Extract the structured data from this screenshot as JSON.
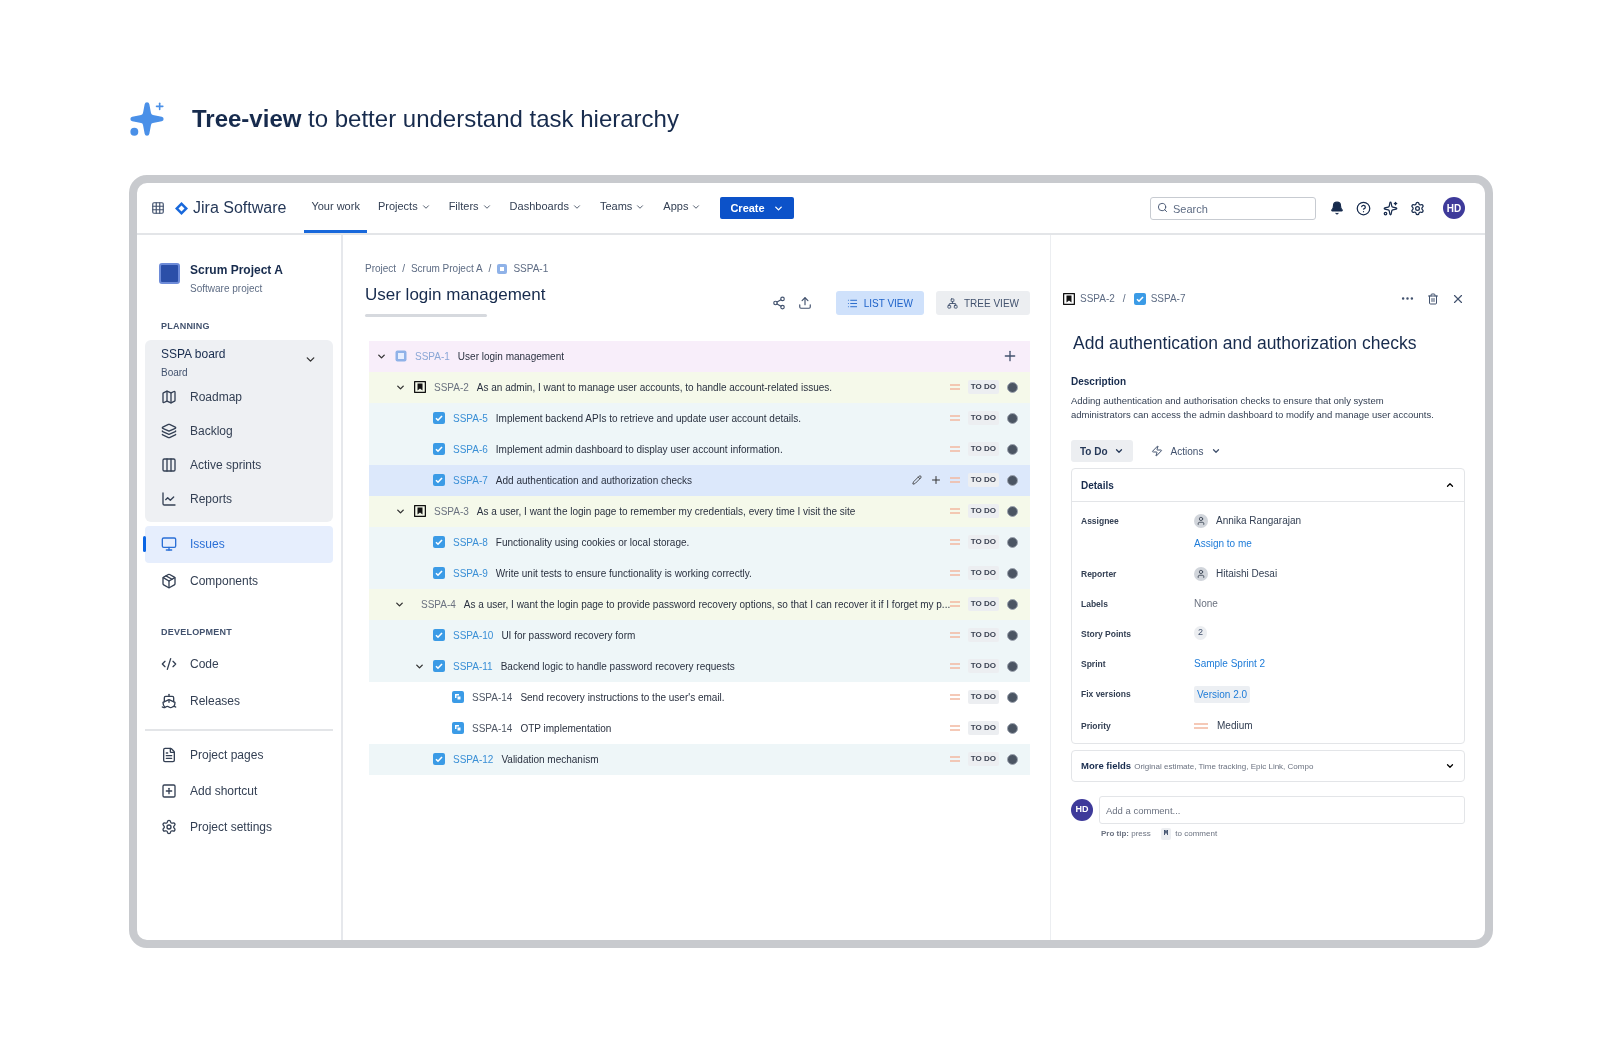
{
  "headline": "**Tree-view** to better understand task hierarchy",
  "topnav": {
    "product": "Jira Software",
    "items": [
      {
        "label": "Your work",
        "selected": true,
        "dropdown": false
      },
      {
        "label": "Projects",
        "selected": false,
        "dropdown": true
      },
      {
        "label": "Filters",
        "selected": false,
        "dropdown": true
      },
      {
        "label": "Dashboards",
        "selected": false,
        "dropdown": true
      },
      {
        "label": "Teams",
        "selected": false,
        "dropdown": true
      },
      {
        "label": "Apps",
        "selected": false,
        "dropdown": true
      }
    ],
    "create": "Create",
    "search": {
      "placeholder": "Search"
    },
    "avatar": "HD"
  },
  "sidebar": {
    "project": {
      "name": "Scrum Project A",
      "type": "Software project"
    },
    "sections": [
      {
        "heading": "PLANNING",
        "items": [
          {
            "kind": "board",
            "label": "SSPA board",
            "sublabel": "Board",
            "expanded": true,
            "children": [
              {
                "label": "Roadmap",
                "selected": false
              },
              {
                "label": "Backlog",
                "selected": false
              },
              {
                "label": "Active sprints",
                "selected": false
              },
              {
                "label": "Reports",
                "selected": false
              }
            ]
          },
          {
            "kind": "link",
            "label": "Issues",
            "selected": true
          },
          {
            "kind": "link",
            "label": "Components",
            "selected": false
          }
        ]
      },
      {
        "heading": "DEVELOPMENT",
        "items": [
          {
            "kind": "link",
            "label": "Code",
            "selected": false
          },
          {
            "kind": "link",
            "label": "Releases",
            "selected": false
          }
        ]
      }
    ],
    "footer": [
      {
        "label": "Project pages"
      },
      {
        "label": "Add shortcut"
      },
      {
        "label": "Project settings"
      }
    ]
  },
  "main": {
    "breadcrumb": [
      "Project",
      "/",
      "Scrum Project A",
      "/",
      "SSPA-1"
    ],
    "title": "User login management",
    "views": [
      {
        "label": "LIST VIEW",
        "selected": true
      },
      {
        "label": "TREE VIEW",
        "selected": false
      }
    ],
    "tree": [
      {
        "kind": "epic",
        "key": "SSPA-1",
        "summary": "User login management",
        "expanded": true,
        "selected": false,
        "children": [
          {
            "kind": "story",
            "key": "SSPA-2",
            "summary": "As an admin, I want to manage user accounts, to handle account-related issues.",
            "status": "TO DO",
            "expanded": true,
            "selected": false,
            "children": [
              {
                "kind": "task",
                "key": "SSPA-5",
                "summary": "Implement backend APIs to retrieve and update user account details.",
                "status": "TO DO",
                "selected": false
              },
              {
                "kind": "task",
                "key": "SSPA-6",
                "summary": "Implement admin dashboard to display user account information.",
                "status": "TO DO",
                "selected": false
              },
              {
                "kind": "task",
                "key": "SSPA-7",
                "summary": "Add authentication and authorization checks",
                "status": "TO DO",
                "selected": true
              }
            ]
          },
          {
            "kind": "story",
            "key": "SSPA-3",
            "summary": "As a user, I want the login page to remember my credentials, every time I visit the site",
            "status": "TO DO",
            "expanded": true,
            "selected": false,
            "children": [
              {
                "kind": "task",
                "key": "SSPA-8",
                "summary": "Functionality using cookies or local storage.",
                "status": "TO DO",
                "selected": false
              },
              {
                "kind": "task",
                "key": "SSPA-9",
                "summary": "Write unit tests to ensure functionality is working correctly.",
                "status": "TO DO",
                "selected": false
              }
            ]
          },
          {
            "kind": "story",
            "key": "SSPA-4",
            "summary": "As a user, I want the login page to provide password recovery options, so that I can recover it if I forget my p...",
            "status": "TO DO",
            "expanded": true,
            "selected": false,
            "children": [
              {
                "kind": "task",
                "key": "SSPA-10",
                "summary": "UI for password recovery form",
                "status": "TO DO",
                "selected": false
              },
              {
                "kind": "task",
                "key": "SSPA-11",
                "summary": "Backend logic to handle password recovery requests",
                "status": "TO DO",
                "expanded": true,
                "selected": false,
                "children": [
                  {
                    "kind": "subtask",
                    "key": "SSPA-14",
                    "summary": "Send recovery instructions to the user's email.",
                    "status": "TO DO",
                    "selected": false
                  },
                  {
                    "kind": "subtask",
                    "key": "SSPA-14",
                    "summary": "OTP implementation",
                    "status": "TO DO",
                    "selected": false
                  }
                ]
              },
              {
                "kind": "task",
                "key": "SSPA-12",
                "summary": "Validation mechanism",
                "status": "TO DO",
                "selected": false
              }
            ]
          }
        ]
      }
    ]
  },
  "detail": {
    "breadcrumb": [
      "SSPA-2",
      "/",
      "SSPA-7"
    ],
    "title": "Add authentication and authorization checks",
    "description_label": "Description",
    "description": "Adding authentication and authorisation checks to ensure that only system administrators can access the admin dashboard to modify and manage user accounts.",
    "status": "To Do",
    "actions": "Actions",
    "details": {
      "title": "Details",
      "expanded": true,
      "fields": [
        {
          "kind": "person",
          "label": "Assignee",
          "value": "Annika Rangarajan",
          "action": "Assign to me"
        },
        {
          "kind": "person",
          "label": "Reporter",
          "value": "Hitaishi Desai"
        },
        {
          "kind": "text",
          "label": "Labels",
          "value": "None"
        },
        {
          "kind": "count",
          "label": "Story Points",
          "value": "2"
        },
        {
          "kind": "link",
          "label": "Sprint",
          "value": "Sample Sprint 2"
        },
        {
          "kind": "tag",
          "label": "Fix versions",
          "value": "Version 2.0"
        },
        {
          "kind": "priority",
          "label": "Priority",
          "value": "Medium"
        }
      ]
    },
    "more_fields": {
      "title": "More fields",
      "hint": "Original estimate, Time tracking, Epic Link, Compo",
      "expanded": false
    },
    "comment": {
      "avatar": "HD",
      "placeholder": "Add a comment...",
      "tip": "**Pro tip:** press",
      "key": "M",
      "tip_end": "to comment"
    }
  }
}
